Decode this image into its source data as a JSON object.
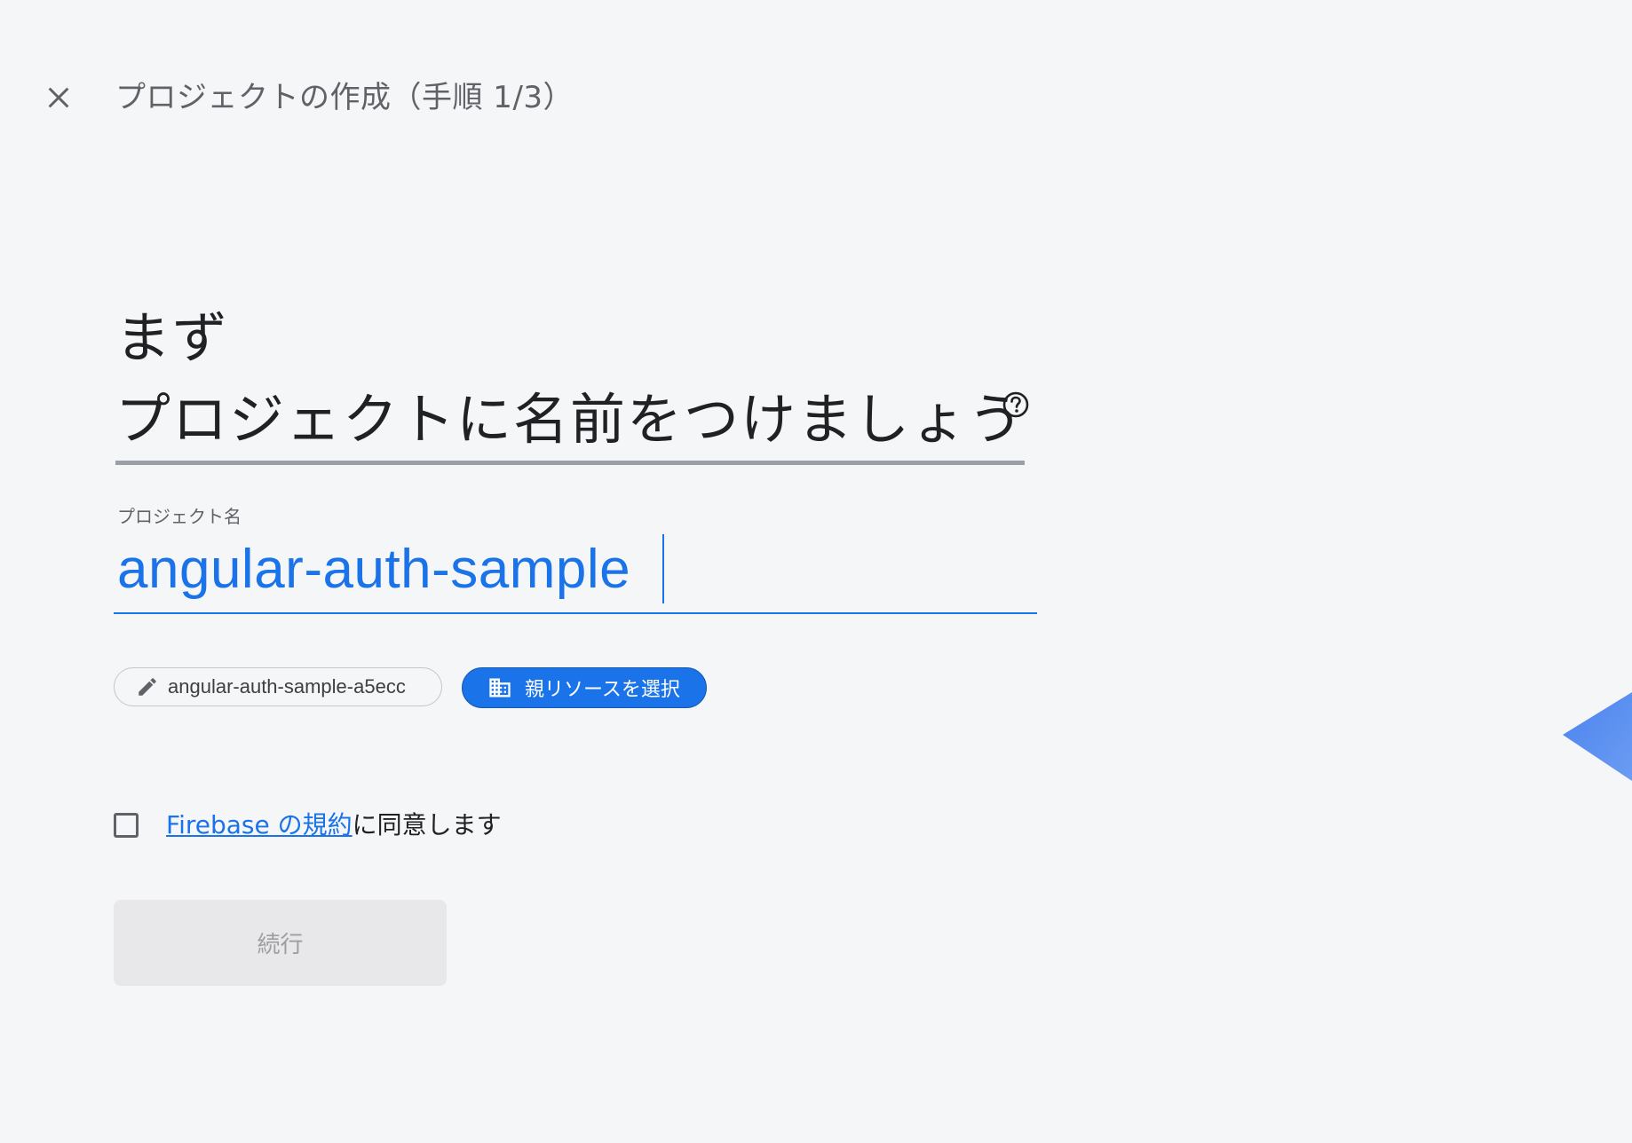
{
  "header": {
    "title": "プロジェクトの作成（手順 1/3）",
    "close_icon": "close-icon"
  },
  "headline": {
    "line1": "まず",
    "line2": "プロジェクトに名前をつけましょう",
    "help_icon": "help-circle-icon"
  },
  "project_name": {
    "label": "プロジェクト名",
    "value": "angular-auth-sample"
  },
  "chips": {
    "project_id": {
      "icon": "pencil-icon",
      "label": "angular-auth-sample-a5ecc"
    },
    "parent_resource": {
      "icon": "building-icon",
      "label": "親リソースを選択"
    }
  },
  "terms": {
    "checked": false,
    "link_text": "Firebase の規約",
    "suffix": "に同意します"
  },
  "continue_button": {
    "label": "続行",
    "enabled": false
  },
  "colors": {
    "accent": "#1a73e8",
    "background": "#f5f6f8",
    "disabled_button": "#e8e8ea"
  }
}
